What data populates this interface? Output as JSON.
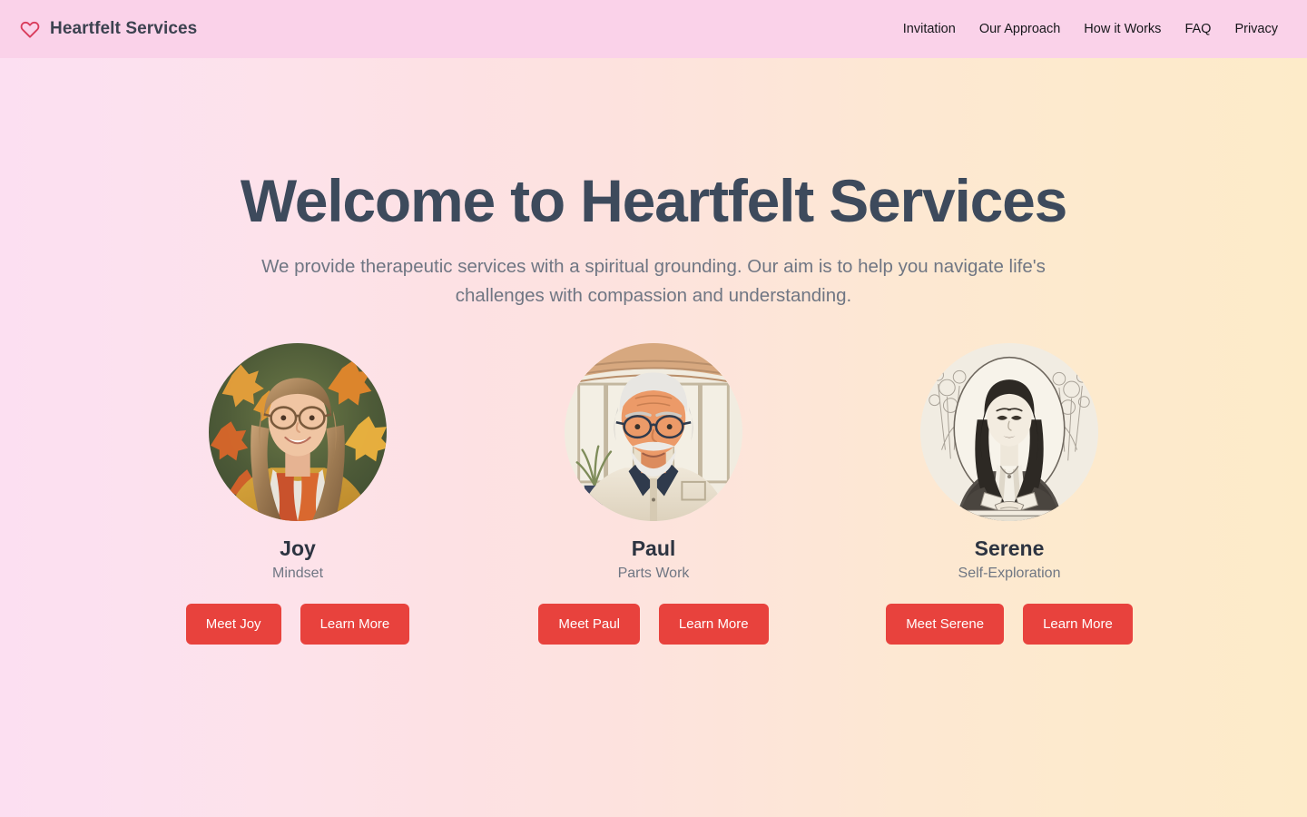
{
  "header": {
    "logo_icon": "heart-outline-icon",
    "brand_name": "Heartfelt Services",
    "nav": [
      {
        "label": "Invitation"
      },
      {
        "label": "Our Approach"
      },
      {
        "label": "How it Works"
      },
      {
        "label": "FAQ"
      },
      {
        "label": "Privacy"
      }
    ]
  },
  "hero": {
    "title": "Welcome to Heartfelt Services",
    "subtitle": "We provide therapeutic services with a spiritual grounding. Our aim is to help you navigate life's challenges with compassion and understanding."
  },
  "profiles": [
    {
      "avatar_icon": "joy-portrait-avatar",
      "name": "Joy",
      "role": "Mindset",
      "primary_button": "Meet Joy",
      "secondary_button": "Learn More"
    },
    {
      "avatar_icon": "paul-portrait-avatar",
      "name": "Paul",
      "role": "Parts Work",
      "primary_button": "Meet Paul",
      "secondary_button": "Learn More"
    },
    {
      "avatar_icon": "serene-portrait-avatar",
      "name": "Serene",
      "role": "Self-Exploration",
      "primary_button": "Meet Serene",
      "secondary_button": "Learn More"
    }
  ],
  "colors": {
    "header_background": "#fad2e9",
    "page_gradient_start": "#fcdff1",
    "page_gradient_end": "#fdebc9",
    "button_red": "#e8423d",
    "heading_slate": "#3d4a5c",
    "muted_gray": "#6f7683",
    "logo_heart": "#d93c5c"
  }
}
